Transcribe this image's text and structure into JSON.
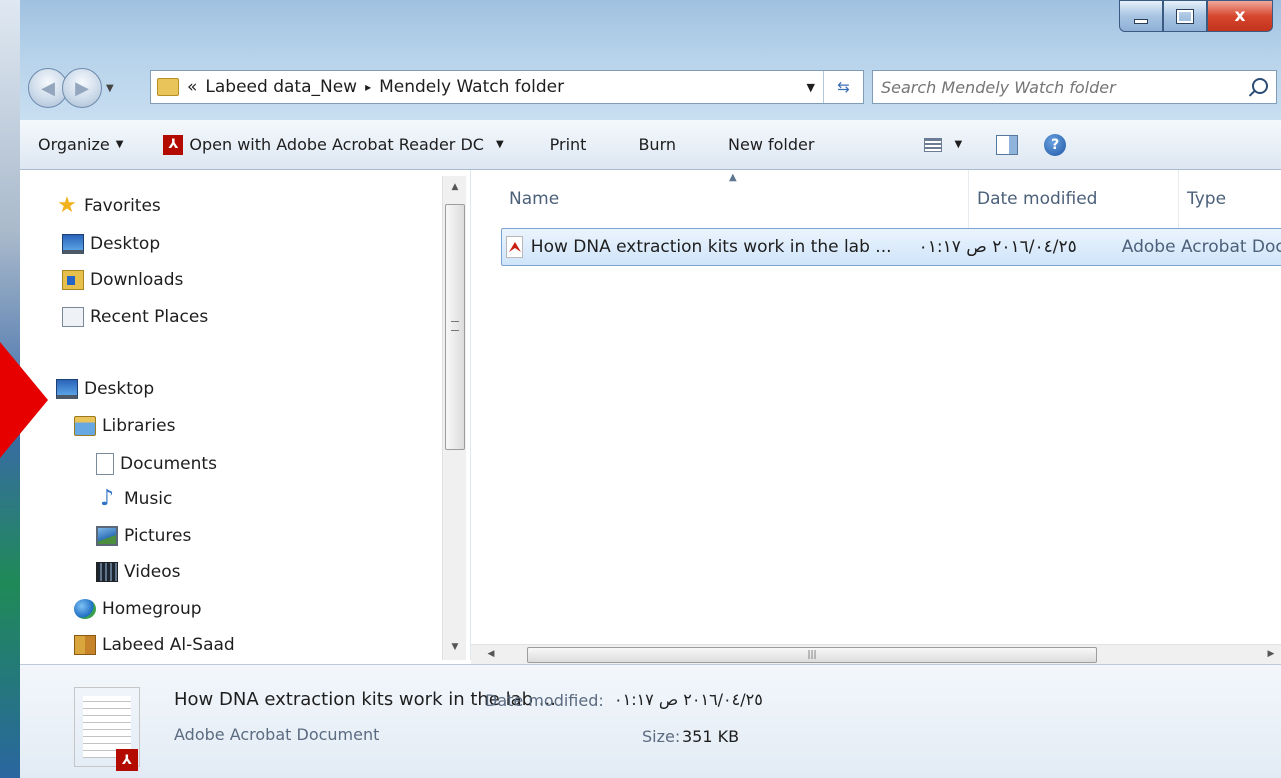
{
  "window": {
    "close_glyph": "x"
  },
  "address": {
    "overflow": "«",
    "parts": [
      "Labeed data_New",
      "Mendely Watch folder"
    ],
    "separator": "▸"
  },
  "search": {
    "placeholder": "Search Mendely Watch folder"
  },
  "toolbar": {
    "organize": "Organize",
    "open_with": "Open with Adobe Acrobat Reader DC",
    "print": "Print",
    "burn": "Burn",
    "new_folder": "New folder",
    "help": "?"
  },
  "nav": {
    "favorites": {
      "label": "Favorites",
      "items": [
        "Desktop",
        "Downloads",
        "Recent Places"
      ]
    },
    "desktop": "Desktop",
    "libraries": {
      "label": "Libraries",
      "items": [
        "Documents",
        "Music",
        "Pictures",
        "Videos"
      ]
    },
    "homegroup": "Homegroup",
    "user": "Labeed Al-Saad"
  },
  "columns": {
    "name": "Name",
    "date_modified": "Date modified",
    "type": "Type"
  },
  "files": [
    {
      "name": "How DNA extraction kits work in the lab ...",
      "date_modified": "٢٠١٦/٠٤/٢٥ ص ٠١:١٧",
      "type": "Adobe Acrobat Document"
    }
  ],
  "details": {
    "name": "How DNA extraction kits work in the lab ...",
    "date_label": "Date modified:",
    "date": "٢٠١٦/٠٤/٢٥ ص ٠١:١٧",
    "type": "Adobe Acrobat Document",
    "size_label": "Size:",
    "size": "351 KB"
  },
  "colors": {
    "selection": "#cfe4fa",
    "accent": "#2364c6",
    "arrow": "#e60000"
  }
}
